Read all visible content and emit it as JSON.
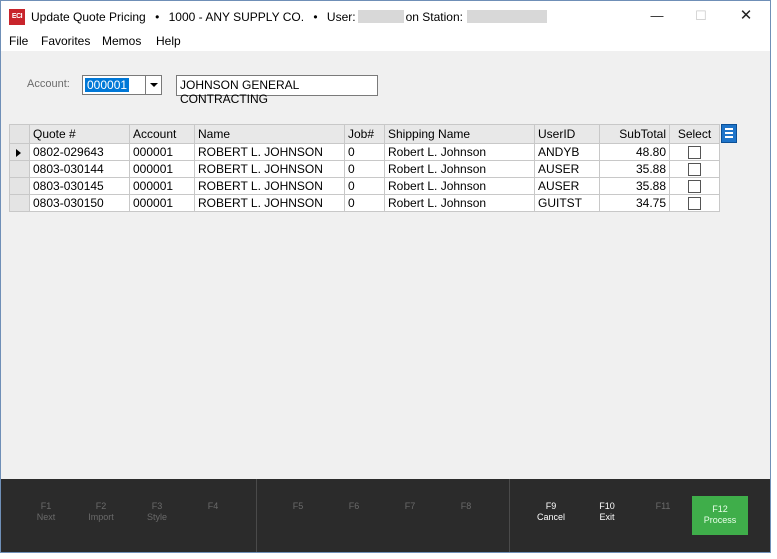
{
  "window": {
    "app_icon_text": "ECI",
    "title": "Update Quote Pricing",
    "bullet": "•",
    "company": "1000 - ANY SUPPLY CO.",
    "user_label": "User:",
    "station_label": "on Station:",
    "min_glyph": "—",
    "max_glyph": "☐",
    "close_glyph": "✕"
  },
  "menu": [
    "File",
    "Favorites",
    "Memos",
    "Help"
  ],
  "account": {
    "label": "Account:",
    "value": "000001",
    "name": "JOHNSON GENERAL CONTRACTING"
  },
  "grid": {
    "columns": [
      "Quote #",
      "Account",
      "Name",
      "Job#",
      "Shipping Name",
      "UserID",
      "SubTotal",
      "Select"
    ],
    "rows": [
      [
        "0802-029643",
        "000001",
        "ROBERT L. JOHNSON",
        "0",
        "Robert L. Johnson",
        "ANDYB",
        "48.80"
      ],
      [
        "0803-030144",
        "000001",
        "ROBERT L. JOHNSON",
        "0",
        "Robert L. Johnson",
        "AUSER",
        "35.88"
      ],
      [
        "0803-030145",
        "000001",
        "ROBERT L. JOHNSON",
        "0",
        "Robert L. Johnson",
        "AUSER",
        "35.88"
      ],
      [
        "0803-030150",
        "000001",
        "ROBERT L. JOHNSON",
        "0",
        "Robert L. Johnson",
        "GUITST",
        "34.75"
      ]
    ],
    "selected": [
      false,
      false,
      false,
      false
    ]
  },
  "footer": {
    "keys": [
      {
        "key": "F1",
        "label": "Next"
      },
      {
        "key": "F2",
        "label": "Import"
      },
      {
        "key": "F3",
        "label": "Style"
      },
      {
        "key": "F4",
        "label": ""
      },
      {
        "key": "F5",
        "label": ""
      },
      {
        "key": "F6",
        "label": ""
      },
      {
        "key": "F7",
        "label": ""
      },
      {
        "key": "F8",
        "label": ""
      },
      {
        "key": "F9",
        "label": "Cancel"
      },
      {
        "key": "F10",
        "label": "Exit"
      },
      {
        "key": "F11",
        "label": ""
      },
      {
        "key": "F12",
        "label": "Process"
      }
    ],
    "process_color": "#3fae4a"
  }
}
